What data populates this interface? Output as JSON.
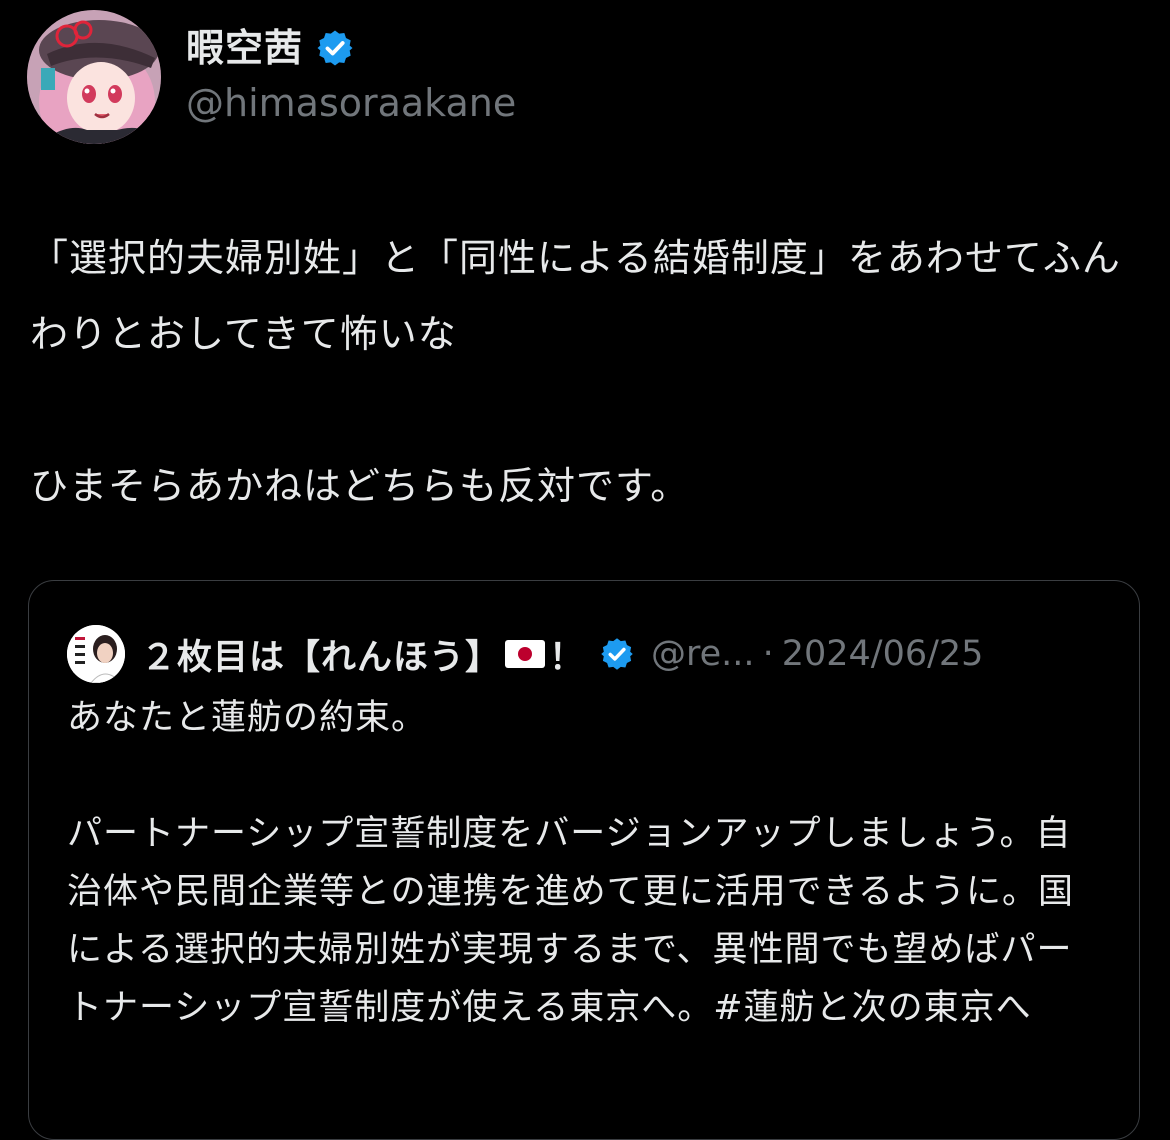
{
  "author": {
    "display_name": "暇空茜",
    "handle": "@himasoraakane",
    "avatar_icon": "anime-character-avatar-icon",
    "verified_icon": "verified-badge-icon"
  },
  "tweet": {
    "text": "「選択的夫婦別姓」と「同性による結婚制度」をあわせてふんわりとおしてきて怖いな\n\nひまそらあかねはどちらも反対です。"
  },
  "quoted_tweet": {
    "display_name": "２枚目は【れんほう】",
    "name_suffix": "！",
    "flag_icon": "japan-flag-icon",
    "verified_icon": "verified-badge-icon",
    "handle": "@re...",
    "separator": "·",
    "date": "2024/06/25",
    "text": "あなたと蓮舫の約束。\n\nパートナーシップ宣誓制度をバージョンアップしましょう。自治体や民間企業等との連携を進めて更に活用できるように。国による選択的夫婦別姓が実現するまで、異性間でも望めばパートナーシップ宣誓制度が使える東京へ。#蓮舫と次の東京へ"
  },
  "colors": {
    "background": "#000000",
    "text_primary": "#e7e9ea",
    "text_secondary": "#71767b",
    "verified_blue": "#1d9bf0",
    "quote_border": "#3a3d41"
  }
}
